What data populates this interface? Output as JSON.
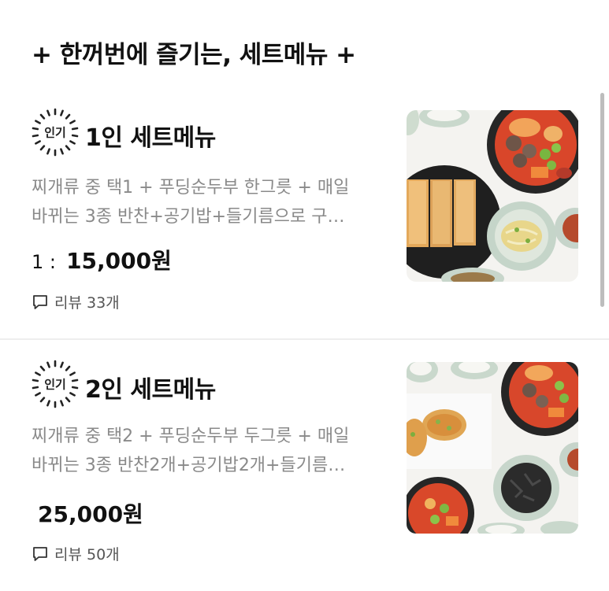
{
  "section": {
    "title": "+ 한꺼번에 즐기는, 세트메뉴 +"
  },
  "items": [
    {
      "badge_label": "인기",
      "name": "1인 세트메뉴",
      "desc_line1": "찌개류 중 택1 + 푸딩순두부 한그릇 + 매일",
      "desc_line2": "바뀌는 3종 반찬+공기밥+들기름으로 구…",
      "price_prefix": "1 :",
      "price": "15,000원",
      "review_label": "리뷰 33개",
      "image_icon": "set-menu-photo"
    },
    {
      "badge_label": "인기",
      "name": "2인 세트메뉴",
      "desc_line1": "찌개류 중 택2 + 푸딩순두부 두그릇 + 매일",
      "desc_line2": "바뀌는 3종 반찬2개+공기밥2개+들기름…",
      "price_prefix": "",
      "price": "25,000원",
      "review_label": "리뷰 50개",
      "image_icon": "set-menu-photo"
    }
  ],
  "colors": {
    "title": "#111111",
    "description": "#8a8a8a",
    "divider": "#eeeeee",
    "scrollbar": "#bdbdbd"
  },
  "icons": {
    "badge": "popular-badge-icon",
    "review": "chat-bubble-icon"
  }
}
